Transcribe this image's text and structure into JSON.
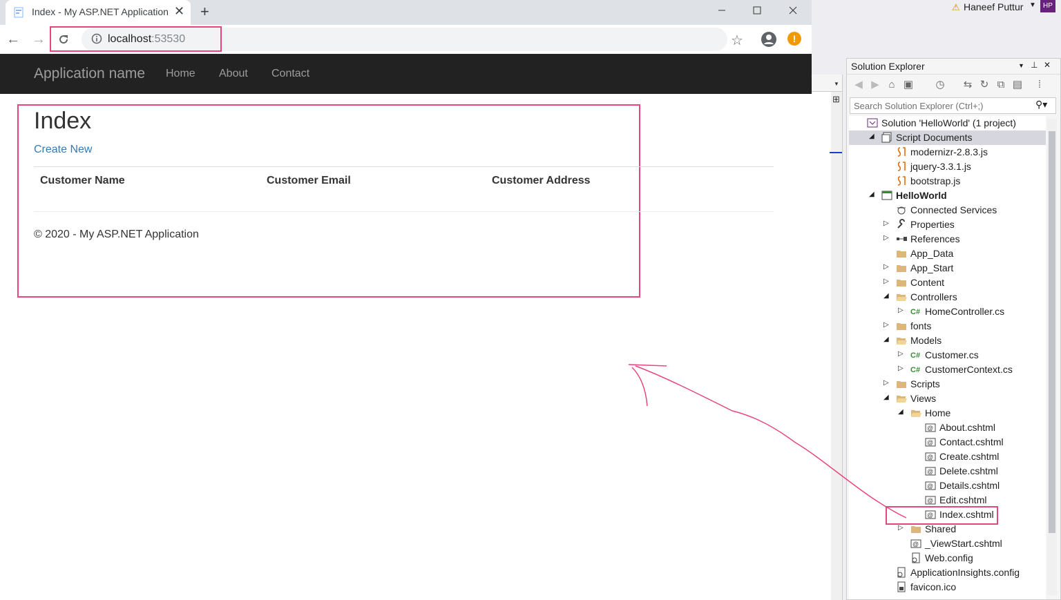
{
  "browser": {
    "tab_title": "Index - My ASP.NET Application",
    "url_host": "localhost",
    "url_port": ":53530"
  },
  "site": {
    "brand": "Application name",
    "nav": [
      "Home",
      "About",
      "Contact"
    ],
    "page_title": "Index",
    "create_new": "Create New",
    "columns": [
      "Customer Name",
      "Customer Email",
      "Customer Address"
    ],
    "footer": "© 2020 - My ASP.NET Application"
  },
  "vs": {
    "user_name": "Haneef Puttur",
    "user_initials": "HP",
    "panel_title": "Solution Explorer",
    "search_placeholder": "Search Solution Explorer (Ctrl+;)",
    "tree": [
      {
        "label": "Solution 'HelloWorld' (1 project)",
        "icon": "solution-icon",
        "expander": ""
      },
      {
        "label": "Script Documents",
        "icon": "script-documents-icon",
        "expander": "◢",
        "grey": true
      },
      {
        "label": "modernizr-2.8.3.js",
        "icon": "js-file-icon",
        "expander": ""
      },
      {
        "label": "jquery-3.3.1.js",
        "icon": "js-file-icon",
        "expander": ""
      },
      {
        "label": "bootstrap.js",
        "icon": "js-file-icon",
        "expander": ""
      },
      {
        "label": "HelloWorld",
        "icon": "web-project-icon",
        "expander": "◢",
        "bold": true
      },
      {
        "label": "Connected Services",
        "icon": "connected-services-icon",
        "expander": ""
      },
      {
        "label": "Properties",
        "icon": "wrench-icon",
        "expander": "▷"
      },
      {
        "label": "References",
        "icon": "references-icon",
        "expander": "▷"
      },
      {
        "label": "App_Data",
        "icon": "folder-icon",
        "expander": ""
      },
      {
        "label": "App_Start",
        "icon": "folder-icon",
        "expander": "▷"
      },
      {
        "label": "Content",
        "icon": "folder-icon",
        "expander": "▷"
      },
      {
        "label": "Controllers",
        "icon": "folder-open-icon",
        "expander": "◢"
      },
      {
        "label": "HomeController.cs",
        "icon": "csharp-file-icon",
        "expander": "▷"
      },
      {
        "label": "fonts",
        "icon": "folder-icon",
        "expander": "▷"
      },
      {
        "label": "Models",
        "icon": "folder-open-icon",
        "expander": "◢"
      },
      {
        "label": "Customer.cs",
        "icon": "csharp-file-icon",
        "expander": "▷"
      },
      {
        "label": "CustomerContext.cs",
        "icon": "csharp-file-icon",
        "expander": "▷"
      },
      {
        "label": "Scripts",
        "icon": "folder-icon",
        "expander": "▷"
      },
      {
        "label": "Views",
        "icon": "folder-open-icon",
        "expander": "◢"
      },
      {
        "label": "Home",
        "icon": "folder-open-icon",
        "expander": "◢"
      },
      {
        "label": "About.cshtml",
        "icon": "razor-file-icon",
        "expander": ""
      },
      {
        "label": "Contact.cshtml",
        "icon": "razor-file-icon",
        "expander": ""
      },
      {
        "label": "Create.cshtml",
        "icon": "razor-file-icon",
        "expander": ""
      },
      {
        "label": "Delete.cshtml",
        "icon": "razor-file-icon",
        "expander": ""
      },
      {
        "label": "Details.cshtml",
        "icon": "razor-file-icon",
        "expander": ""
      },
      {
        "label": "Edit.cshtml",
        "icon": "razor-file-icon",
        "expander": ""
      },
      {
        "label": "Index.cshtml",
        "icon": "razor-file-icon",
        "expander": ""
      },
      {
        "label": "Shared",
        "icon": "folder-icon",
        "expander": "▷"
      },
      {
        "label": "_ViewStart.cshtml",
        "icon": "razor-file-icon",
        "expander": ""
      },
      {
        "label": "Web.config",
        "icon": "config-file-icon",
        "expander": ""
      },
      {
        "label": "ApplicationInsights.config",
        "icon": "config-file-icon",
        "expander": ""
      },
      {
        "label": "favicon.ico",
        "icon": "ico-file-icon",
        "expander": ""
      }
    ]
  },
  "colors": {
    "highlight": "#e8457e",
    "navbar": "#222222",
    "link": "#337ab7"
  }
}
